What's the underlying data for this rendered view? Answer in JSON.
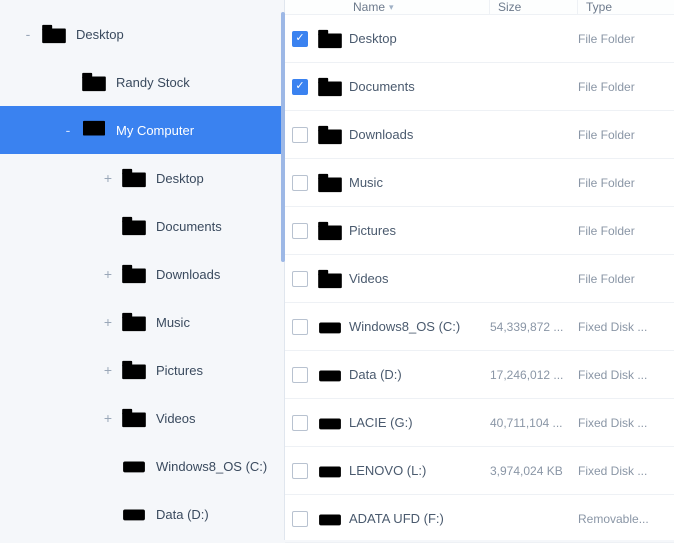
{
  "columns": {
    "name": "Name",
    "size": "Size",
    "type": "Type"
  },
  "tree": [
    {
      "label": "Desktop",
      "icon": "folder",
      "depth": 0,
      "expander": "-",
      "selected": false
    },
    {
      "label": "Randy Stock",
      "icon": "folder",
      "depth": 1,
      "expander": "",
      "selected": false
    },
    {
      "label": "My Computer",
      "icon": "monitor",
      "depth": 1,
      "expander": "-",
      "selected": true
    },
    {
      "label": "Desktop",
      "icon": "folder-outline",
      "depth": 2,
      "expander": "+",
      "selected": false
    },
    {
      "label": "Documents",
      "icon": "folder-outline",
      "depth": 2,
      "expander": "",
      "selected": false
    },
    {
      "label": "Downloads",
      "icon": "folder-outline",
      "depth": 2,
      "expander": "+",
      "selected": false
    },
    {
      "label": "Music",
      "icon": "folder-outline",
      "depth": 2,
      "expander": "+",
      "selected": false
    },
    {
      "label": "Pictures",
      "icon": "folder-outline",
      "depth": 2,
      "expander": "+",
      "selected": false
    },
    {
      "label": "Videos",
      "icon": "folder-outline",
      "depth": 2,
      "expander": "+",
      "selected": false
    },
    {
      "label": "Windows8_OS (C:)",
      "icon": "drive",
      "depth": 2,
      "expander": "",
      "selected": false
    },
    {
      "label": "Data (D:)",
      "icon": "drive",
      "depth": 2,
      "expander": "",
      "selected": false
    }
  ],
  "rows": [
    {
      "name": "Desktop",
      "size": "",
      "type": "File Folder",
      "icon": "folder-outline",
      "checked": true
    },
    {
      "name": "Documents",
      "size": "",
      "type": "File Folder",
      "icon": "folder-outline",
      "checked": true
    },
    {
      "name": "Downloads",
      "size": "",
      "type": "File Folder",
      "icon": "folder-outline",
      "checked": false
    },
    {
      "name": "Music",
      "size": "",
      "type": "File Folder",
      "icon": "folder-outline",
      "checked": false
    },
    {
      "name": "Pictures",
      "size": "",
      "type": "File Folder",
      "icon": "folder-outline",
      "checked": false
    },
    {
      "name": "Videos",
      "size": "",
      "type": "File Folder",
      "icon": "folder-outline",
      "checked": false
    },
    {
      "name": "Windows8_OS (C:)",
      "size": "54,339,872 ...",
      "type": "Fixed Disk ...",
      "icon": "drive-outline",
      "checked": false
    },
    {
      "name": "Data (D:)",
      "size": "17,246,012 ...",
      "type": "Fixed Disk ...",
      "icon": "drive-outline",
      "checked": false
    },
    {
      "name": "LACIE (G:)",
      "size": "40,711,104 ...",
      "type": "Fixed Disk ...",
      "icon": "drive-outline",
      "checked": false
    },
    {
      "name": "LENOVO (L:)",
      "size": "3,974,024 KB",
      "type": "Fixed Disk ...",
      "icon": "drive-outline",
      "checked": false
    },
    {
      "name": "ADATA UFD (F:)",
      "size": "",
      "type": "Removable...",
      "icon": "drive-outline",
      "checked": false
    }
  ]
}
